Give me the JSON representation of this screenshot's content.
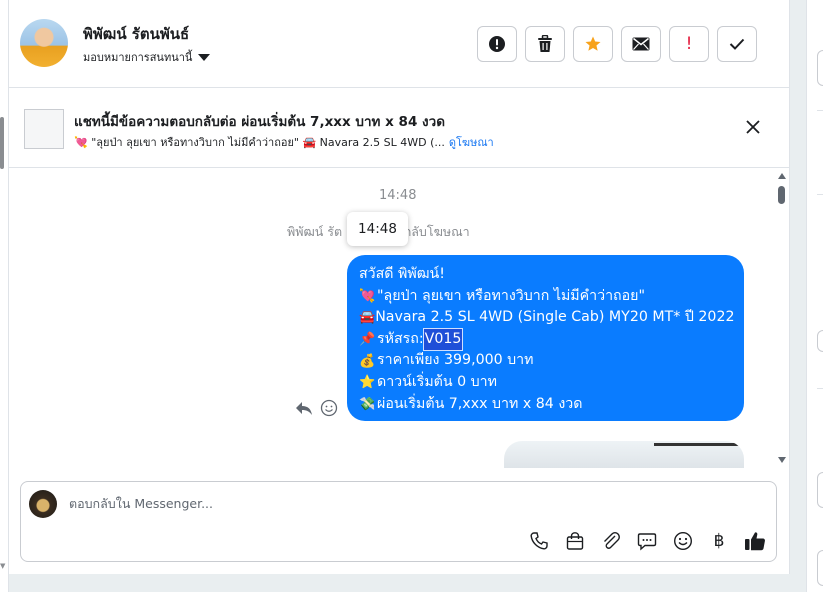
{
  "contact": {
    "name": "พิพัฒน์ รัตนพันธ์",
    "assign_label": "มอบหมายการสนทนานี้"
  },
  "toolbar": {
    "buttons": [
      {
        "name": "mark-spam-button",
        "icon": "exclamation-circle-icon"
      },
      {
        "name": "delete-button",
        "icon": "trash-icon"
      },
      {
        "name": "star-button",
        "icon": "star-icon"
      },
      {
        "name": "mark-unread-button",
        "icon": "envelope-icon"
      },
      {
        "name": "follow-up-button",
        "icon": "exclamation-icon",
        "label": "!"
      },
      {
        "name": "done-button",
        "icon": "checkmark-icon"
      }
    ]
  },
  "ad_bar": {
    "title": "แชทนี้มีข้อความตอบกลับต่อ ผ่อนเริ่มต้น 7,xxx บาท x 84 งวด",
    "subtitle": "💘 \"ลุยป่า ลุยเขา หรือทางวิบาก ไม่มีคำว่าถอย\" 🚘 Navara 2.5 SL 4WD (...",
    "link": "ดูโฆษณา"
  },
  "chat": {
    "timestamp": "14:48",
    "info_left": "พิพัฒน์ รัต",
    "info_right": "กกลับโฆษณา",
    "tooltip": "14:48",
    "message": {
      "lines": [
        {
          "emoji": "",
          "text": "สวัสดี พิพัฒน์!"
        },
        {
          "emoji": "💘",
          "text": "\"ลุยป่า ลุยเขา หรือทางวิบาก ไม่มีคำว่าถอย\""
        },
        {
          "emoji": "🚘",
          "text": "Navara 2.5 SL 4WD (Single Cab) MY20 MT* ปี 2022"
        },
        {
          "emoji": "📌",
          "text": "รหัสรถ: "
        },
        {
          "emoji": "💰",
          "text": "ราคาเพียง 399,000 บาท"
        },
        {
          "emoji": "⭐",
          "text": "ดาวน์เริ่มต้น 0 บาท"
        },
        {
          "emoji": "💸",
          "text": "ผ่อนเริ่มต้น 7,xxx บาท x 84 งวด"
        }
      ],
      "highlight": "V015"
    }
  },
  "composer": {
    "placeholder": "ตอบกลับใน Messenger..."
  },
  "composer_tools": {
    "currency_symbol": "฿"
  },
  "colors": {
    "bubble": "#0a7cff",
    "accent": "#1877f2",
    "star": "#f7a21b",
    "alert": "#e41e3f"
  }
}
